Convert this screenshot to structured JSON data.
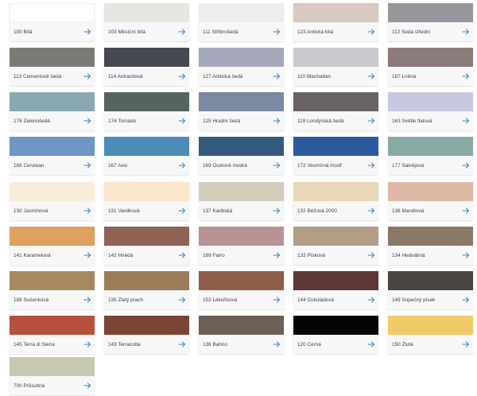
{
  "accent": "#3a86c4",
  "arrow_icon": "arrow-right-icon",
  "colors": [
    {
      "name": "100 Bílá",
      "hex": "#ffffff"
    },
    {
      "name": "103 Měsíční bílá",
      "hex": "#e4e6df"
    },
    {
      "name": "111 Stříbrošedá",
      "hex": "#ecedef"
    },
    {
      "name": "123 Antická bílá",
      "hex": "#d8c9c1"
    },
    {
      "name": "112 Šedá střední",
      "hex": "#96979c"
    },
    {
      "name": "113 Cementově šedá",
      "hex": "#7b7b76"
    },
    {
      "name": "114 Antracitová",
      "hex": "#454850"
    },
    {
      "name": "127 Arktická šedá",
      "hex": "#a4a8b8"
    },
    {
      "name": "110 Manhattan",
      "hex": "#cbc9cd"
    },
    {
      "name": "187 Lněná",
      "hex": "#8c7b7b"
    },
    {
      "name": "176 Zelenošedá",
      "hex": "#89a8b1"
    },
    {
      "name": "174 Tornádo",
      "hex": "#566460"
    },
    {
      "name": "125 Hradní šedá",
      "hex": "#7b89a3"
    },
    {
      "name": "119 Londýnská šedá",
      "hex": "#686266"
    },
    {
      "name": "163 Světle fialová",
      "hex": "#c9c8e2"
    },
    {
      "name": "168 Cerulean",
      "hex": "#6e95c4"
    },
    {
      "name": "167 Avio",
      "hex": "#4b8cb8"
    },
    {
      "name": "169 Ocelově modrá",
      "hex": "#365a7e"
    },
    {
      "name": "172 Vesmírná modř",
      "hex": "#2b5a9d"
    },
    {
      "name": "177 Šalvějová",
      "hex": "#87aaa5"
    },
    {
      "name": "130 Jasmínová",
      "hex": "#f7eddb"
    },
    {
      "name": "131 Vanilková",
      "hex": "#fbe5cb"
    },
    {
      "name": "137 Karibská",
      "hex": "#d3cdbc"
    },
    {
      "name": "132 Béžová 2000",
      "hex": "#ecd7b9"
    },
    {
      "name": "138 Mandlová",
      "hex": "#deb9a5"
    },
    {
      "name": "141 Karamelová",
      "hex": "#e0a060"
    },
    {
      "name": "142 Hnědá",
      "hex": "#8f6255"
    },
    {
      "name": "189 Farro",
      "hex": "#b89396"
    },
    {
      "name": "133 Písková",
      "hex": "#b39d86"
    },
    {
      "name": "134 Hedvábná",
      "hex": "#8a7866"
    },
    {
      "name": "188 Sušenková",
      "hex": "#a88a62"
    },
    {
      "name": "135 Zlatý prach",
      "hex": "#9d7c5a"
    },
    {
      "name": "152 Lékořicová",
      "hex": "#8f5e49"
    },
    {
      "name": "144 Čokoládová",
      "hex": "#5f3736"
    },
    {
      "name": "149 Sopečný písek",
      "hex": "#474442"
    },
    {
      "name": "145 Terra di Siena",
      "hex": "#b5503a"
    },
    {
      "name": "143 Terracotta",
      "hex": "#7b4437"
    },
    {
      "name": "136 Bahno",
      "hex": "#6c5f56"
    },
    {
      "name": "120 Černá",
      "hex": "#050505"
    },
    {
      "name": "150 Žlutá",
      "hex": "#f3ca6a"
    },
    {
      "name": "700 Průsvitná",
      "hex": "#c8c8b0"
    }
  ]
}
